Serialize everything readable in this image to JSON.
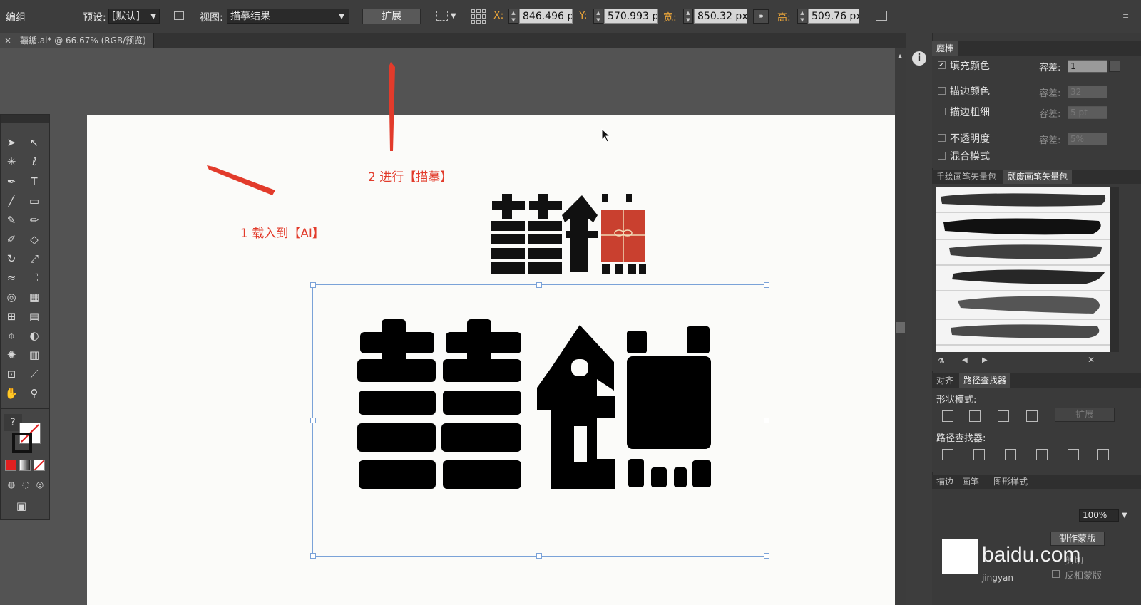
{
  "control_bar": {
    "selection_type": "编组",
    "preset_label": "预设:",
    "preset_value": "[默认]",
    "view_label": "视图:",
    "view_value": "描摹结果",
    "expand_button": "扩展",
    "x_label": "X:",
    "x_value": "846.496 p",
    "y_label": "Y:",
    "y_value": "570.993 p",
    "w_label": "宽:",
    "w_value": "850.32 px",
    "h_label": "高:",
    "h_value": "509.76 px"
  },
  "document_tab": {
    "close": "×",
    "title": "囍鍎.ai* @ 66.67% (RGB/预览)"
  },
  "annotations": {
    "step1": "1 载入到【AI】",
    "step2": "2 进行【描摹】"
  },
  "artwork": {
    "small_characters": "囍鍎",
    "large_characters": "囍鍎"
  },
  "tools_panel": {
    "help_glyph": "?"
  },
  "magic_wand_panel": {
    "title": "魔棒",
    "fill_color": {
      "label": "填充颜色",
      "checked": true,
      "tolerance_label": "容差:",
      "tolerance": "1"
    },
    "stroke_color": {
      "label": "描边颜色",
      "checked": false,
      "tolerance_label": "容差:",
      "tolerance": "32"
    },
    "stroke_weight": {
      "label": "描边粗细",
      "checked": false,
      "tolerance_label": "容差:",
      "tolerance": "5 pt"
    },
    "opacity": {
      "label": "不透明度",
      "checked": false,
      "tolerance_label": "容差:",
      "tolerance": "5%"
    },
    "blend_mode": {
      "label": "混合模式",
      "checked": false
    }
  },
  "brush_panel": {
    "tabs": [
      "手绘画笔矢量包",
      "颓废画笔矢量包"
    ],
    "active_tab": 1
  },
  "pathfinder_panel": {
    "tabs": [
      "对齐",
      "路径查找器"
    ],
    "shape_modes_label": "形状模式:",
    "expand_button": "扩展",
    "pathfinders_label": "路径查找器:"
  },
  "bottom_panel": {
    "tabs": [
      "描边",
      "画笔",
      "图形样式"
    ],
    "opacity_value": "100%",
    "make_mask_button": "制作蒙版",
    "clip_label": "剪切",
    "invert_mask_label": "反相蒙版"
  },
  "watermark": {
    "text": "baidu.com",
    "sub": "jingyan"
  },
  "colors": {
    "annotation_red": "#e23b2b",
    "stamp_red": "#c9402f",
    "selection_blue": "#7aa2d8",
    "orange_label": "#e8a43a"
  }
}
